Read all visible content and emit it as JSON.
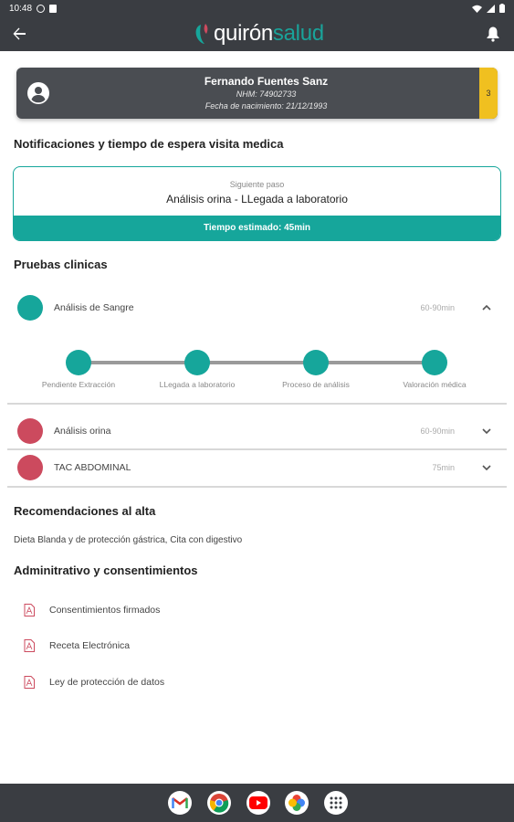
{
  "status_bar": {
    "time": "10:48"
  },
  "app_bar": {
    "brand_part1": "quirón",
    "brand_part2": "salud"
  },
  "patient": {
    "name": "Fernando Fuentes Sanz",
    "nhm": "NHM: 74902733",
    "birth": "Fecha de nacimiento: 21/12/1993",
    "badge": "3"
  },
  "notifications": {
    "title": "Notificaciones y tiempo de espera visita medica",
    "next_label": "Siguiente paso",
    "next_value": "Análisis orina - LLegada a laboratorio",
    "estimated": "Tiempo estimado: 45min"
  },
  "tests": {
    "title": "Pruebas clinicas",
    "items": [
      {
        "name": "Análisis de Sangre",
        "time": "60-90min",
        "status_color": "#16a69b",
        "expanded": true
      },
      {
        "name": "Análisis orina",
        "time": "60-90min",
        "status_color": "#cc4a5e",
        "expanded": false
      },
      {
        "name": "TAC ABDOMINAL",
        "time": "75min",
        "status_color": "#cc4a5e",
        "expanded": false
      }
    ],
    "steps": [
      "Pendiente Extracción",
      "LLegada a laboratorio",
      "Proceso de análisis",
      "Valoración médica"
    ]
  },
  "recommendations": {
    "title": "Recomendaciones al alta",
    "text": "Dieta Blanda y de protección gástrica, Cita con digestivo"
  },
  "admin": {
    "title": "Adminitrativo y consentimientos",
    "docs": [
      "Consentimientos firmados",
      "Receta Electrónica",
      "Ley de protección de datos"
    ]
  },
  "colors": {
    "accent": "#16a69b",
    "alert": "#cc4a5e",
    "badge": "#f0c020",
    "bar": "#3a3d42"
  },
  "nav_apps": [
    "gmail-icon",
    "chrome-icon",
    "youtube-icon",
    "photos-icon",
    "apps-icon"
  ]
}
